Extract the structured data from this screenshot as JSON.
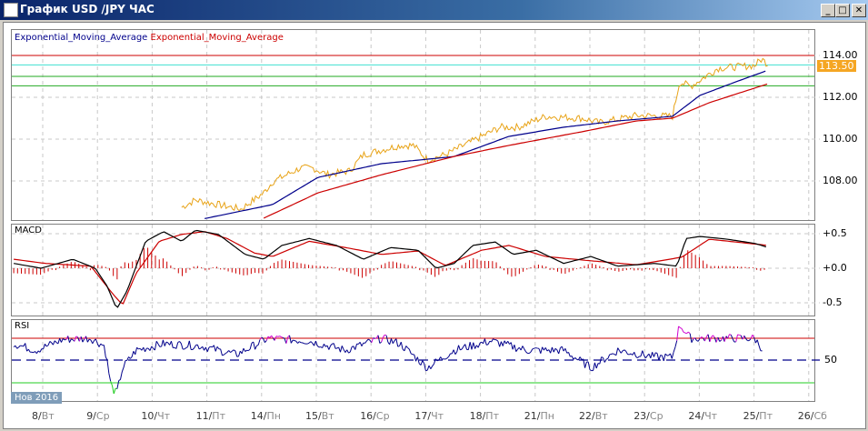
{
  "window": {
    "title": "График USD /JPY  ЧАС",
    "minimize": "_",
    "maximize": "□",
    "close": "✕"
  },
  "legend": {
    "ema1": "Exponential_Moving_Average",
    "ema2": "Exponential_Moving_Average"
  },
  "panels": {
    "macd": "MACD",
    "rsi": "RSI"
  },
  "period_badge": "Нов 2016",
  "current_price": "113.50",
  "colors": {
    "price": "#e8a317",
    "ema_fast": "#00008b",
    "ema_slow": "#cc0000",
    "macd": "#000000",
    "signal": "#cc0000",
    "rsi": "#00008b",
    "rsi_high": "#d000d0",
    "hline_red": "#cc0000",
    "hline_cyan": "#40e0d0",
    "hline_green": "#22aa22"
  },
  "chart_data": [
    {
      "type": "line",
      "title": "USD/JPY H1",
      "ylim": [
        105.9,
        115.2
      ],
      "yticks": [
        "114.00",
        "112.00",
        "110.00",
        "108.00"
      ],
      "ytick_values": [
        114,
        112,
        110,
        108
      ],
      "xticks": [
        {
          "d": "8",
          "w": "Вт"
        },
        {
          "d": "9",
          "w": "Ср"
        },
        {
          "d": "10",
          "w": "Чт"
        },
        {
          "d": "11",
          "w": "Пт"
        },
        {
          "d": "14",
          "w": "Пн"
        },
        {
          "d": "15",
          "w": "Вт"
        },
        {
          "d": "16",
          "w": "Ср"
        },
        {
          "d": "17",
          "w": "Чт"
        },
        {
          "d": "18",
          "w": "Пт"
        },
        {
          "d": "21",
          "w": "Пн"
        },
        {
          "d": "22",
          "w": "Вт"
        },
        {
          "d": "23",
          "w": "Ср"
        },
        {
          "d": "24",
          "w": "Чт"
        },
        {
          "d": "25",
          "w": "Пт"
        },
        {
          "d": "26",
          "w": "Сб"
        }
      ],
      "hlines": [
        {
          "v": 114.0,
          "c": "hline_red"
        },
        {
          "v": 113.55,
          "c": "hline_cyan"
        },
        {
          "v": 113.0,
          "c": "hline_green"
        },
        {
          "v": 112.55,
          "c": "hline_green"
        }
      ],
      "series": [
        {
          "name": "price",
          "x": [
            2.54,
            2.79,
            3.62,
            4.04,
            4.2,
            4.7,
            4.95,
            5.2,
            5.61,
            5.86,
            6.53,
            6.78,
            7.03,
            7.36,
            7.86,
            8.36,
            8.69,
            9.19,
            9.85,
            10.18,
            10.85,
            11.51,
            11.64,
            11.84,
            12.34,
            13.01,
            13.14,
            13.26
          ],
          "y": [
            106.74,
            107.09,
            106.65,
            107.43,
            107.96,
            108.61,
            108.61,
            108.3,
            108.48,
            109.26,
            109.7,
            109.7,
            109.0,
            109.26,
            109.91,
            110.57,
            110.57,
            111.09,
            111.0,
            110.78,
            111.13,
            111.09,
            112.74,
            112.52,
            113.39,
            113.52,
            113.83,
            113.57
          ]
        },
        {
          "name": "Exponential_Moving_Average",
          "x": [
            2.96,
            4.2,
            5.03,
            6.2,
            7.03,
            7.52,
            8.52,
            9.52,
            10.51,
            11.51,
            12.01,
            12.67,
            13.26
          ],
          "y": [
            106.2,
            106.87,
            108.17,
            108.83,
            109.04,
            109.17,
            110.13,
            110.57,
            110.87,
            111.09,
            112.09,
            112.74,
            113.3
          ]
        },
        {
          "name": "Exponential_Moving_Average",
          "x": [
            4.04,
            5.03,
            6.2,
            7.52,
            8.52,
            9.85,
            10.85,
            11.51,
            12.18,
            13.26
          ],
          "y": [
            106.22,
            107.43,
            108.3,
            109.17,
            109.7,
            110.35,
            110.87,
            111.0,
            111.74,
            112.65
          ]
        }
      ]
    },
    {
      "type": "line",
      "title": "MACD",
      "ylim": [
        -0.82,
        0.65
      ],
      "yticks": [
        "+0.5",
        "+0.0",
        "-0.5"
      ],
      "ytick_values": [
        0.5,
        0,
        -0.5
      ],
      "series": [
        {
          "name": "macd",
          "x": [
            -0.53,
            -0.03,
            0.55,
            0.96,
            1.18,
            1.35,
            1.54,
            1.88,
            2.21,
            2.54,
            2.79,
            3.21,
            3.7,
            4.04,
            4.37,
            4.87,
            5.37,
            5.86,
            6.36,
            6.86,
            7.19,
            7.52,
            7.86,
            8.27,
            8.6,
            9.02,
            9.52,
            10.02,
            10.51,
            11.18,
            11.59,
            11.76,
            12.01,
            12.51,
            13.01,
            13.26
          ],
          "y": [
            0.07,
            0,
            0.13,
            0,
            -0.26,
            -0.59,
            -0.33,
            0.39,
            0.53,
            0.39,
            0.55,
            0.49,
            0.2,
            0.13,
            0.33,
            0.43,
            0.33,
            0.13,
            0.3,
            0.26,
            0,
            0.07,
            0.33,
            0.38,
            0.2,
            0.26,
            0.07,
            0.17,
            0.03,
            0.07,
            0.03,
            0.43,
            0.46,
            0.42,
            0.36,
            0.3
          ]
        },
        {
          "name": "signal",
          "x": [
            -0.53,
            0.05,
            0.88,
            1.3,
            1.46,
            1.71,
            2.13,
            2.54,
            2.96,
            3.37,
            3.87,
            4.2,
            4.87,
            5.53,
            6.2,
            6.86,
            7.36,
            8.02,
            8.52,
            9.19,
            9.85,
            10.85,
            11.68,
            12.18,
            13.26
          ],
          "y": [
            0.13,
            0.07,
            0.03,
            -0.39,
            -0.53,
            -0.07,
            0.39,
            0.49,
            0.53,
            0.43,
            0.22,
            0.17,
            0.39,
            0.3,
            0.2,
            0.25,
            0.04,
            0.26,
            0.33,
            0.17,
            0.12,
            0.05,
            0.16,
            0.42,
            0.33
          ]
        }
      ]
    },
    {
      "type": "line",
      "title": "RSI",
      "ylim": [
        0,
        100
      ],
      "yticks": [
        "50"
      ],
      "ytick_values": [
        50
      ],
      "levels": [
        70,
        50,
        30
      ],
      "series": [
        {
          "name": "rsi",
          "x": [
            -0.53,
            -0.12,
            0.38,
            0.88,
            1.13,
            1.25,
            1.35,
            1.46,
            1.71,
            2.21,
            2.88,
            3.54,
            4.12,
            4.87,
            5.53,
            6.2,
            6.53,
            7.03,
            7.52,
            8.19,
            8.85,
            9.52,
            10.02,
            10.51,
            11.18,
            11.51,
            11.64,
            11.84,
            12.51,
            13.01,
            13.17
          ],
          "y": [
            65,
            59,
            69,
            70,
            63,
            26,
            19,
            43,
            59,
            65,
            63,
            55,
            70,
            67.5,
            59,
            70,
            65,
            43,
            59,
            67.5,
            59,
            59,
            43,
            59,
            53,
            52.5,
            82.5,
            70,
            70,
            70,
            59
          ]
        }
      ]
    }
  ]
}
